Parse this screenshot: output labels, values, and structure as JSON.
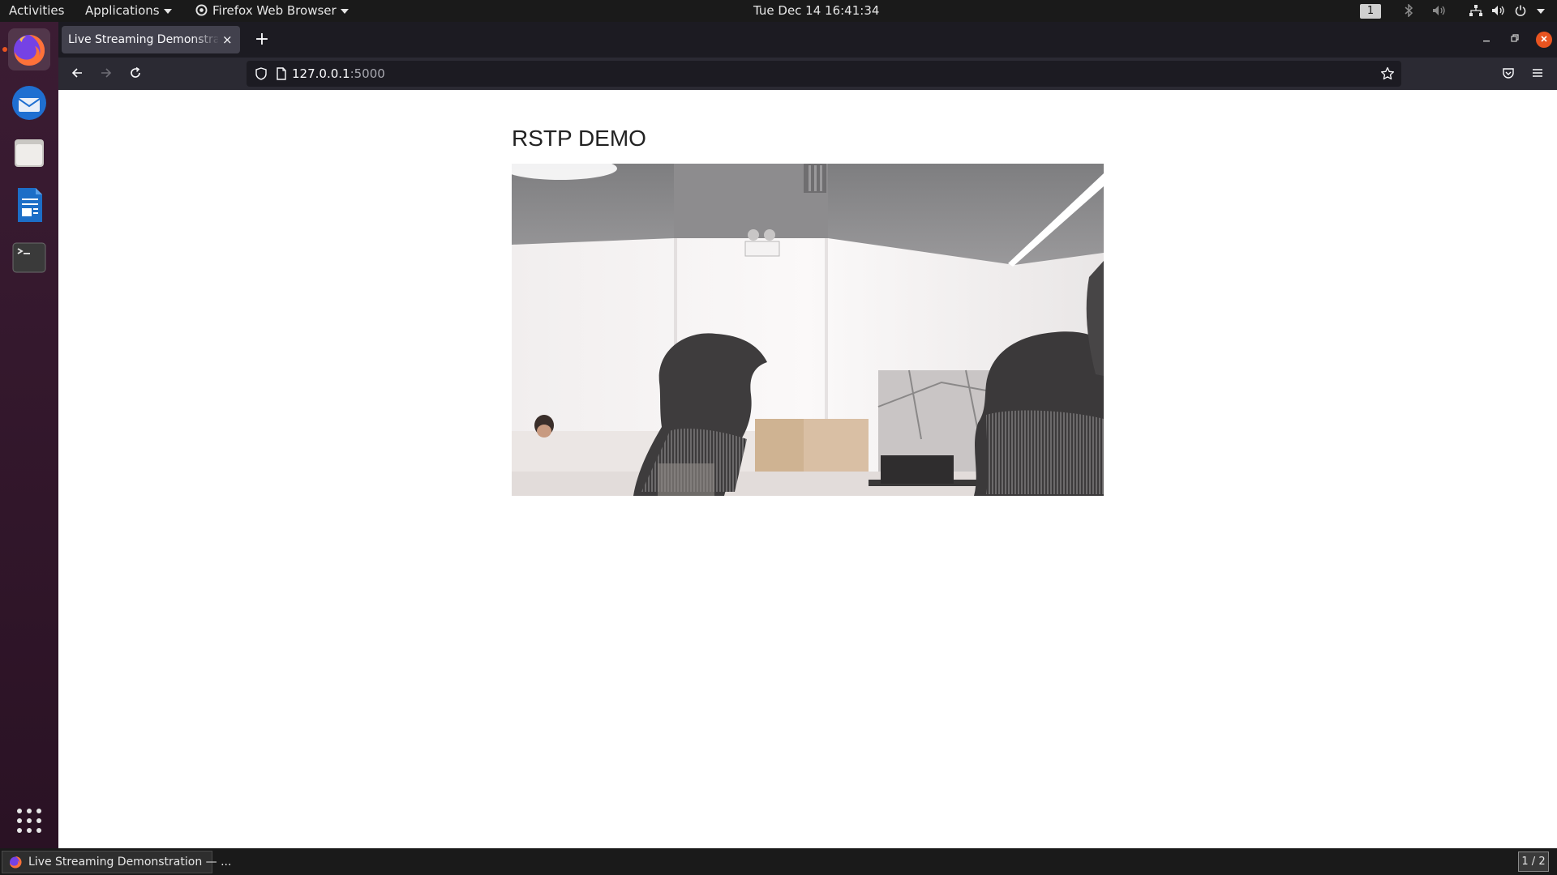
{
  "topbar": {
    "activities": "Activities",
    "applications": "Applications",
    "app_menu": "Firefox Web Browser",
    "clock": "Tue Dec 14  16:41:34",
    "workspace": "1"
  },
  "browser": {
    "tab_title": "Live Streaming Demonstration",
    "tab_close": "×",
    "new_tab": "+",
    "url_host": "127.0.0.1",
    "url_port": ":5000"
  },
  "page": {
    "title": "RSTP DEMO"
  },
  "taskbar": {
    "window_label": "Live Streaming Demonstration — ...",
    "pager": "1 / 2"
  },
  "colors": {
    "accent": "#e95420",
    "dock": "#3b1c33",
    "tabbar": "#1c1b22",
    "navbar": "#2b2a33"
  }
}
